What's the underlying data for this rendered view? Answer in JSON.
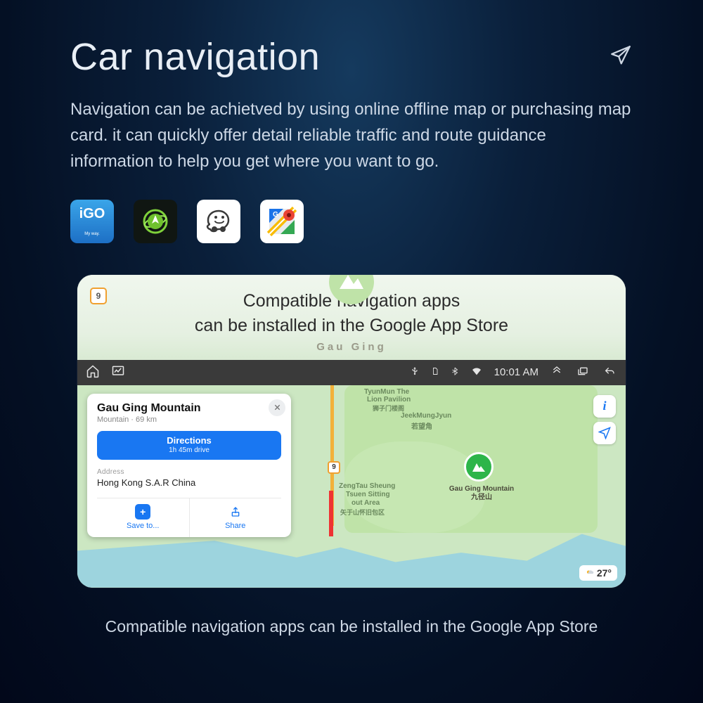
{
  "header": {
    "title": "Car navigation"
  },
  "description": "Navigation can be achietved by using online offline map or purchasing map card. it can quickly offer detail reliable traffic and route guidance information to help you get where you want to go.",
  "appIcons": {
    "igo": "iGO",
    "igo_sub": "My way."
  },
  "frame": {
    "headline_l1": "Compatible navigation apps",
    "headline_l2": "can be installed in the Google App Store",
    "gauging": "Gau Ging",
    "badge": "9"
  },
  "statusbar": {
    "time": "10:01 AM"
  },
  "map": {
    "road_badge": "9",
    "labels": {
      "jeekmung": "JeekMungJyun",
      "jeekmung_cn": "若望角",
      "zengtau": "ZengTau Sheung",
      "tsuen": "Tsuen Sitting",
      "outarea": "out Area",
      "shan": "矢于山怀旧包区",
      "tyunmun": "TyunMun The",
      "lion": "Lion Pavilion",
      "lion_cn": "狮子门楼阁"
    },
    "mountain_label_l1": "Gau Ging",
    "mountain_label_l2": "Mountain",
    "mountain_label_cn": "九径山",
    "info_btn": "i",
    "temperature": "27°"
  },
  "infoCard": {
    "title": "Gau Ging Mountain",
    "subtitle": "Mountain · 69 km",
    "directions_label": "Directions",
    "directions_sub": "1h 45m drive",
    "address_label": "Address",
    "address_value": "Hong Kong S.A.R China",
    "save_label": "Save to...",
    "share_label": "Share"
  },
  "footer": "Compatible navigation apps can be installed in the Google App Store"
}
